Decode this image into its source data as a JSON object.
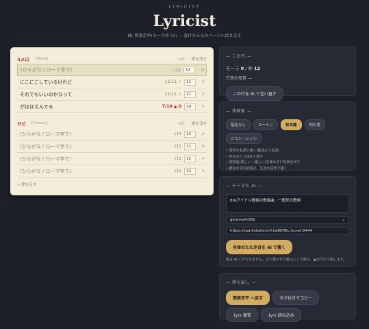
{
  "header": {
    "brand": "LYRICIST",
    "title": "Lyricist",
    "subtitle": "曲: 筒美京平(モーラ枠 03) — 書けたら元のページへ戻せます"
  },
  "paper": {
    "sections": [
      {
        "name": "Aメロ",
        "tag": "[Verse]",
        "add_line": "+行",
        "delete": "節を消す",
        "lines": [
          {
            "text": "(ひらがな / ローマ字で)",
            "placeholder": true,
            "count": "-/12",
            "status": "",
            "num": "12",
            "active": true
          },
          {
            "text": "にこにこしているけれど",
            "placeholder": false,
            "count": "11/11 ✓",
            "status": "ok",
            "num": "11",
            "active": false
          },
          {
            "text": "それでもいいのかなって",
            "placeholder": false,
            "count": "11/11 ✓",
            "status": "ok",
            "num": "11",
            "active": false
          },
          {
            "text": "がほほえんでる",
            "placeholder": false,
            "count": "7/10 ▲-3",
            "status": "bad",
            "num": "10",
            "active": false
          }
        ]
      },
      {
        "name": "サビ",
        "tag": "[Chorus]",
        "add_line": "+行",
        "delete": "節を消す",
        "lines": [
          {
            "text": "(ひらがな / ローマ字で)",
            "placeholder": true,
            "count": "-/14",
            "status": "",
            "num": "14",
            "active": false
          },
          {
            "text": "(ひらがな / ローマ字で)",
            "placeholder": true,
            "count": "-/11",
            "status": "",
            "num": "11",
            "active": false
          },
          {
            "text": "(ひらがな / ローマ字で)",
            "placeholder": true,
            "count": "-/12",
            "status": "",
            "num": "12",
            "active": false
          },
          {
            "text": "(ひらがな / ローマ字で)",
            "placeholder": true,
            "count": "-/12",
            "status": "",
            "num": "12",
            "active": false
          }
        ]
      }
    ],
    "add_section": "+ 節を足す",
    "remove_symbol": "×"
  },
  "panel_line": {
    "heading": "— この行 —",
    "mora_label": "モーラ",
    "mora_value": "0",
    "slot_label": "/ 枠",
    "slot_value": "12",
    "tail": "行末の母音 —",
    "rewrite_button": "この行を AI で言い直す"
  },
  "panel_lyricist": {
    "heading": "— 作詞家 —",
    "chips": [
      {
        "label": "指定なし",
        "selected": false
      },
      {
        "label": "ユーミン",
        "selected": false
      },
      {
        "label": "松本隆",
        "selected": true
      },
      {
        "label": "阿久悠",
        "selected": false
      },
      {
        "label": "ジョン・レノン",
        "selected": false
      }
    ],
    "bullets": [
      "情景を名詞で描く(動詞より名詞)",
      "色をひとつ決めて通す",
      "感情語(寂しい・優しい)を使わずに情景を出す",
      "都会の中の孤独を、生活の具体で描く"
    ]
  },
  "panel_theme": {
    "heading": "— テーマと AI —",
    "theme_value": "80sアイドル歌謡の歌謡曲、一般形の歌詞",
    "model_value": "gemma4:26b",
    "endpoint_value": "https://sparkstation10.tail6f06c.ts.net:8444",
    "draft_button": "全体のたたき台を AI で書く",
    "note": "数は AI に守らせません。文で書かせて数はここで数え、▲の行だけ直します。"
  },
  "panel_export": {
    "heading": "— 持ち出し —",
    "buttons": [
      {
        "label": "筒美京平 へ戻す",
        "primary": true
      },
      {
        "label": "タグ付きでコピー",
        "primary": false
      },
      {
        "label": ".lyrx 保存",
        "primary": false
      },
      {
        "label": ".lyrx 読み込み",
        "primary": false
      }
    ]
  }
}
